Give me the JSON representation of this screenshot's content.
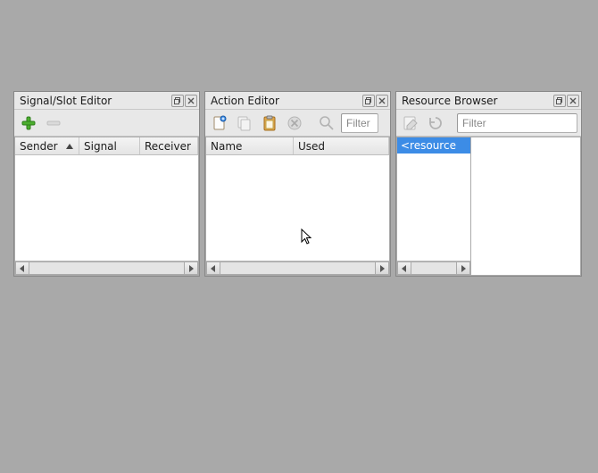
{
  "panels": {
    "signal_slot": {
      "title": "Signal/Slot Editor",
      "columns": [
        "Sender",
        "Signal",
        "Receiver"
      ]
    },
    "action_editor": {
      "title": "Action Editor",
      "filter_placeholder": "Filter",
      "columns": [
        "Name",
        "Used"
      ]
    },
    "resource_browser": {
      "title": "Resource Browser",
      "filter_placeholder": "Filter",
      "root_item": "<resource"
    }
  }
}
